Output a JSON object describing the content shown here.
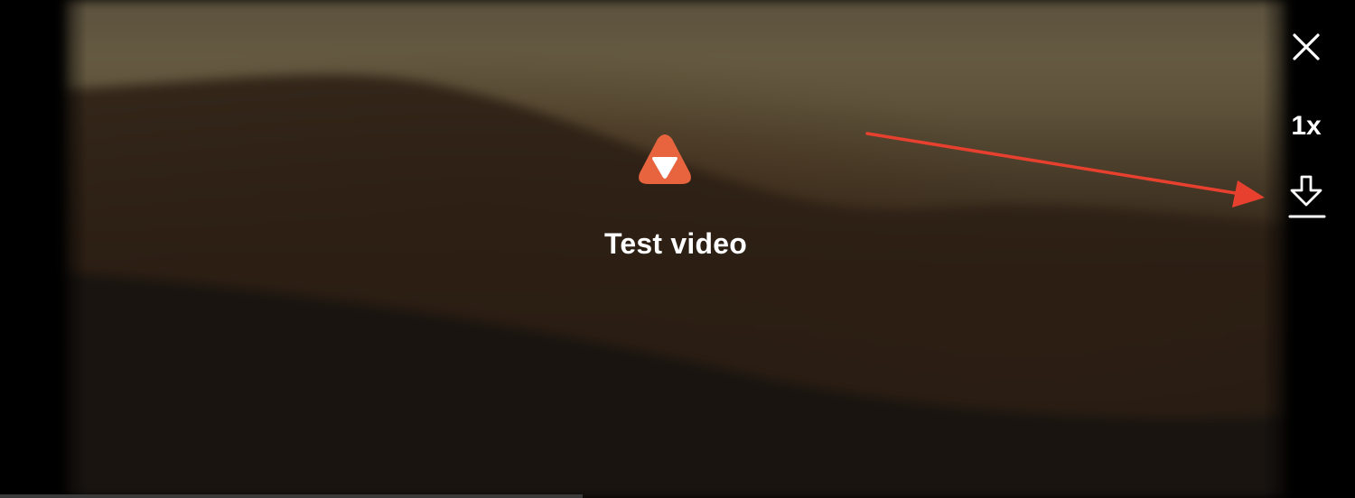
{
  "video": {
    "title": "Test video"
  },
  "controls": {
    "close_icon": "close-icon",
    "speed_label": "1x",
    "download_icon": "download-icon"
  },
  "colors": {
    "brand_accent": "#E8643F",
    "annotation_arrow": "#E8402F",
    "control_foreground": "#FFFFFF",
    "background": "#000000"
  }
}
